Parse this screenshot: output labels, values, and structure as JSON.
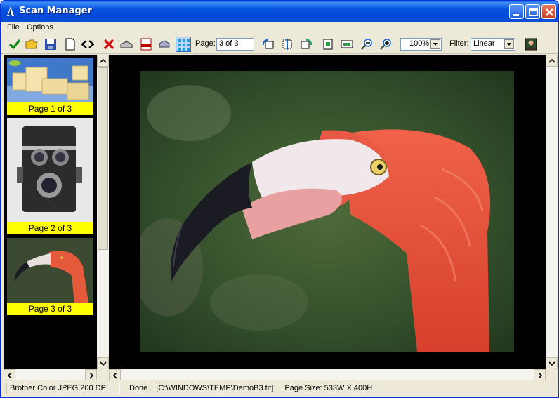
{
  "window": {
    "title": "Scan Manager"
  },
  "menu": [
    "File",
    "Options"
  ],
  "toolbar": {
    "page_label": "Page:",
    "page_value": "3 of 3",
    "zoom_value": "100%",
    "filter_label": "Filter:",
    "filter_value": "Linear"
  },
  "thumbnails": [
    {
      "caption": "Page 1 of 3",
      "subject": "boxes"
    },
    {
      "caption": "Page 2 of 3",
      "subject": "camera"
    },
    {
      "caption": "Page 3 of 3",
      "subject": "flamingo"
    }
  ],
  "status": {
    "scanner": "Brother Color JPEG 200 DPI",
    "state": "Done",
    "file": "[C:\\WINDOWS\\TEMP\\DemoB3.tif]",
    "page_size": "Page Size: 533W X 400H"
  },
  "colors": {
    "title_bar": "#0653e0",
    "caption_bg": "#ffff00",
    "viewer_bg": "#000000"
  },
  "icons": [
    "accept-check-icon",
    "open-folder-icon",
    "save-disk-icon",
    "new-page-icon",
    "swap-arrows-icon",
    "delete-x-icon",
    "scanner-icon",
    "pdf-icon",
    "print-icon",
    "thumbnail-grid-icon",
    "rotate-left-icon",
    "flip-icon",
    "rotate-right-icon",
    "fit-page-icon",
    "fit-width-icon",
    "zoom-out-icon",
    "zoom-in-icon",
    "portrait-icon"
  ]
}
